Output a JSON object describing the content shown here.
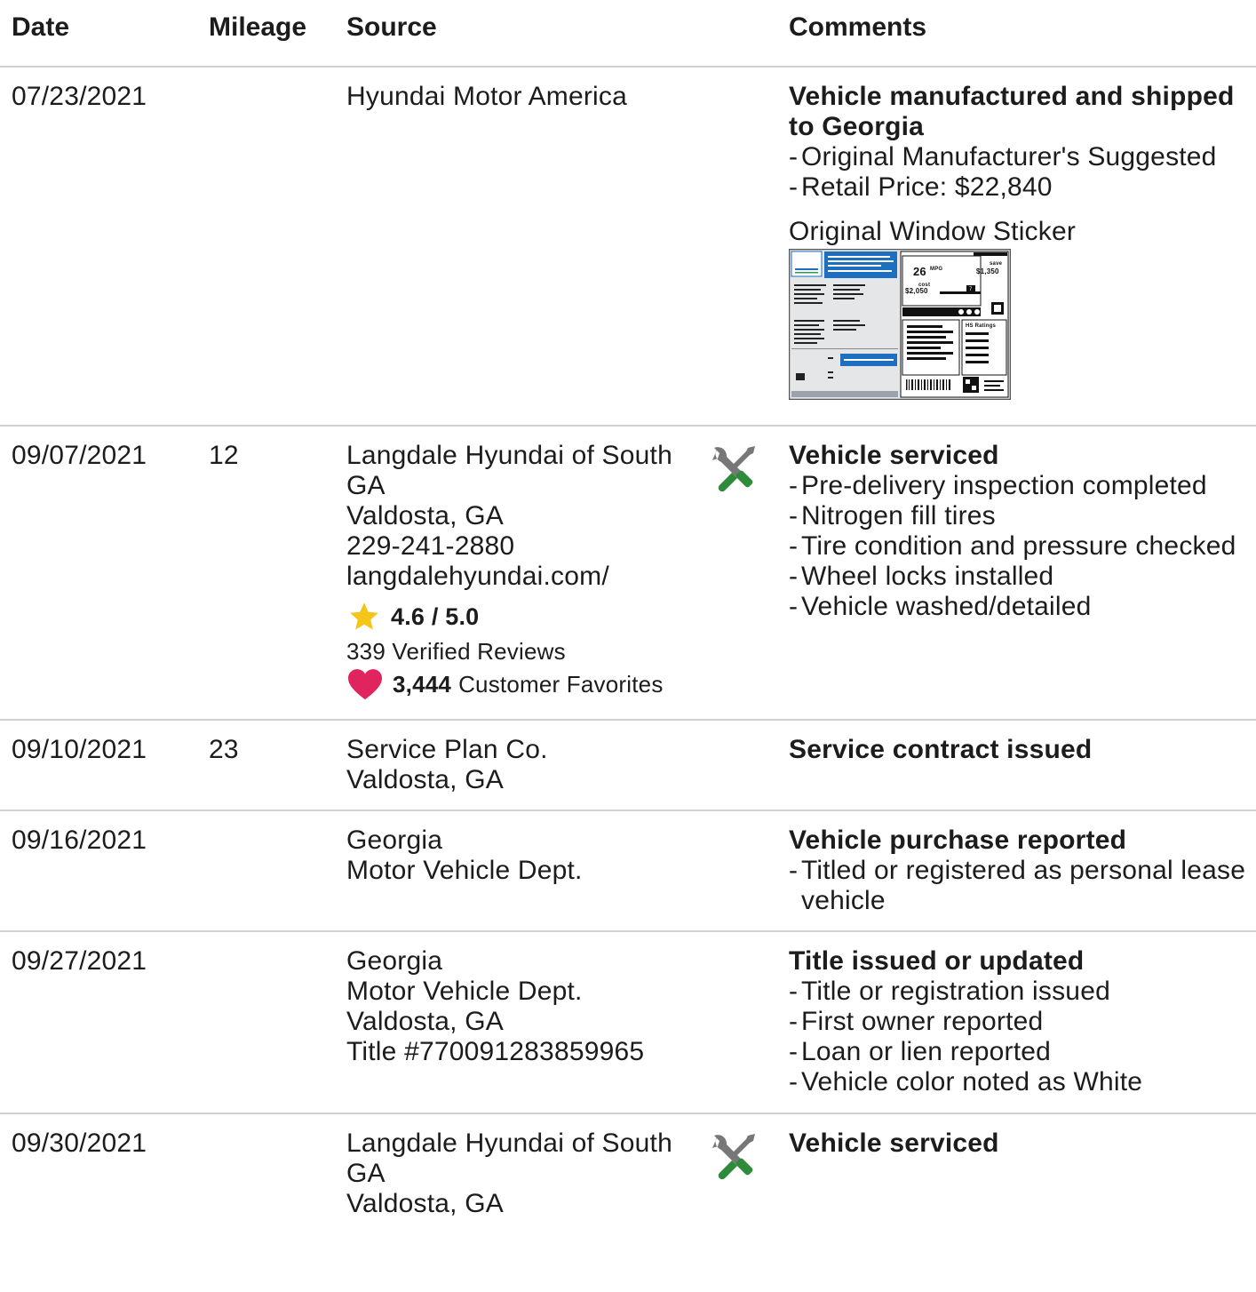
{
  "columns": {
    "date": "Date",
    "mileage": "Mileage",
    "source": "Source",
    "comments": "Comments"
  },
  "records": [
    {
      "date": "07/23/2021",
      "mileage": "",
      "source": [
        "Hyundai Motor America"
      ],
      "comment_title": "Vehicle manufactured and shipped to Georgia",
      "comment_items": [
        "Original Manufacturer's Suggested",
        "Retail Price: $22,840"
      ],
      "sticker_label": "Original Window Sticker",
      "sticker": {
        "mpg": "26",
        "mpg_unit": "MPG",
        "save_label": "save",
        "save_value": "$1,350",
        "cost_label": "cost",
        "cost_value": "$2,050",
        "rating_mark": "7",
        "ratings_title": "HS Ratings"
      }
    },
    {
      "date": "09/07/2021",
      "mileage": "12",
      "source": [
        "Langdale Hyundai of South GA",
        "Valdosta, GA",
        "229-241-2880",
        "langdalehyundai.com/"
      ],
      "rating": "4.6 / 5.0",
      "reviews": "339 Verified Reviews",
      "favorites_count": "3,444",
      "favorites_label": "Customer Favorites",
      "comment_title": "Vehicle serviced",
      "comment_items": [
        "Pre-delivery inspection completed",
        "Nitrogen fill tires",
        "Tire condition and pressure checked",
        "Wheel locks installed",
        "Vehicle washed/detailed"
      ]
    },
    {
      "date": "09/10/2021",
      "mileage": "23",
      "source": [
        "Service Plan Co.",
        "Valdosta, GA"
      ],
      "comment_title": "Service contract issued",
      "comment_items": []
    },
    {
      "date": "09/16/2021",
      "mileage": "",
      "source": [
        "Georgia",
        "Motor Vehicle Dept."
      ],
      "comment_title": "Vehicle purchase reported",
      "comment_items": [
        "Titled or registered as personal lease vehicle"
      ]
    },
    {
      "date": "09/27/2021",
      "mileage": "",
      "source": [
        "Georgia",
        "Motor Vehicle Dept.",
        "Valdosta, GA",
        "Title #770091283859965"
      ],
      "comment_title": "Title issued or updated",
      "comment_items": [
        "Title or registration issued",
        "First owner reported",
        "Loan or lien reported",
        "Vehicle color noted as White"
      ]
    },
    {
      "date": "09/30/2021",
      "mileage": "",
      "source": [
        "Langdale Hyundai of South GA",
        "Valdosta, GA"
      ],
      "comment_title": "Vehicle serviced",
      "comment_items": []
    }
  ],
  "icons": {
    "service": "wrench-screwdriver-icon",
    "rating": "star-icon",
    "favorite": "heart-icon"
  },
  "colors": {
    "divider": "#d2d2d2",
    "star": "#f5c518",
    "heart": "#e0245e",
    "service_icon_green": "#2e8b3a",
    "service_icon_gray": "#777777",
    "sticker_blue": "#1e6fc0"
  }
}
